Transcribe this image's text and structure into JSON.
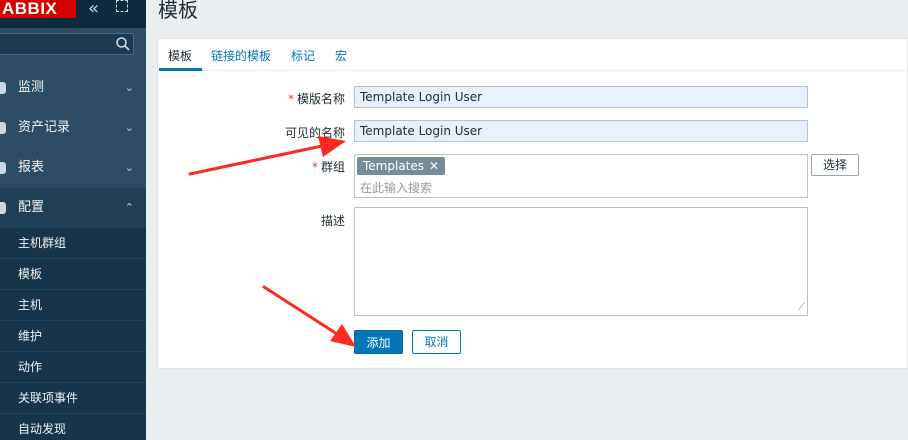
{
  "sidebar": {
    "logo": "ABBIX",
    "nav": [
      {
        "label": "监测",
        "chevron": "⌄"
      },
      {
        "label": "资产记录",
        "chevron": "⌄"
      },
      {
        "label": "报表",
        "chevron": "⌄"
      },
      {
        "label": "配置",
        "chevron": "⌃"
      }
    ],
    "sub_items": [
      "主机群组",
      "模板",
      "主机",
      "维护",
      "动作",
      "关联项事件",
      "自动发现"
    ]
  },
  "header": {
    "title": "模板"
  },
  "tabs": [
    "模板",
    "链接的模板",
    "标记",
    "宏"
  ],
  "form": {
    "template_name_label": "模版名称",
    "template_name_value": "Template Login User",
    "visible_name_label": "可见的名称",
    "visible_name_value": "Template Login User",
    "groups_label": "群组",
    "group_tag": "Templates",
    "groups_placeholder": "在此输入搜索",
    "select_button": "选择",
    "description_label": "描述",
    "add_button": "添加",
    "cancel_button": "取消"
  },
  "colors": {
    "accent": "#0275b8",
    "required": "#e33734",
    "annotation_arrow": "#ff2a1f"
  }
}
